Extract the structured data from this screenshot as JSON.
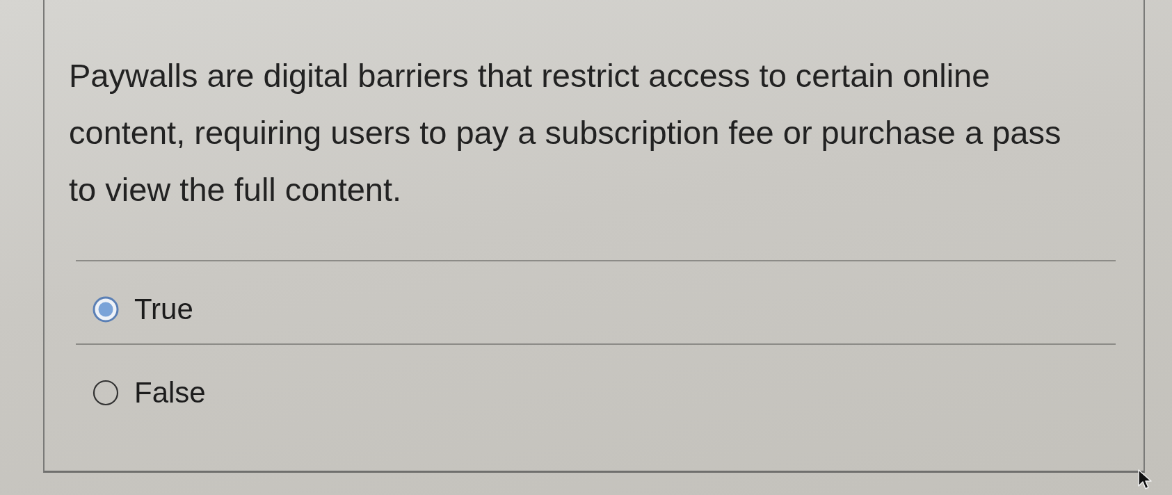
{
  "question": {
    "text": "Paywalls are digital barriers that restrict access to certain online content, requiring users to pay a subscription fee or purchase a pass to view the full content."
  },
  "options": [
    {
      "label": "True",
      "selected": true
    },
    {
      "label": "False",
      "selected": false
    }
  ]
}
